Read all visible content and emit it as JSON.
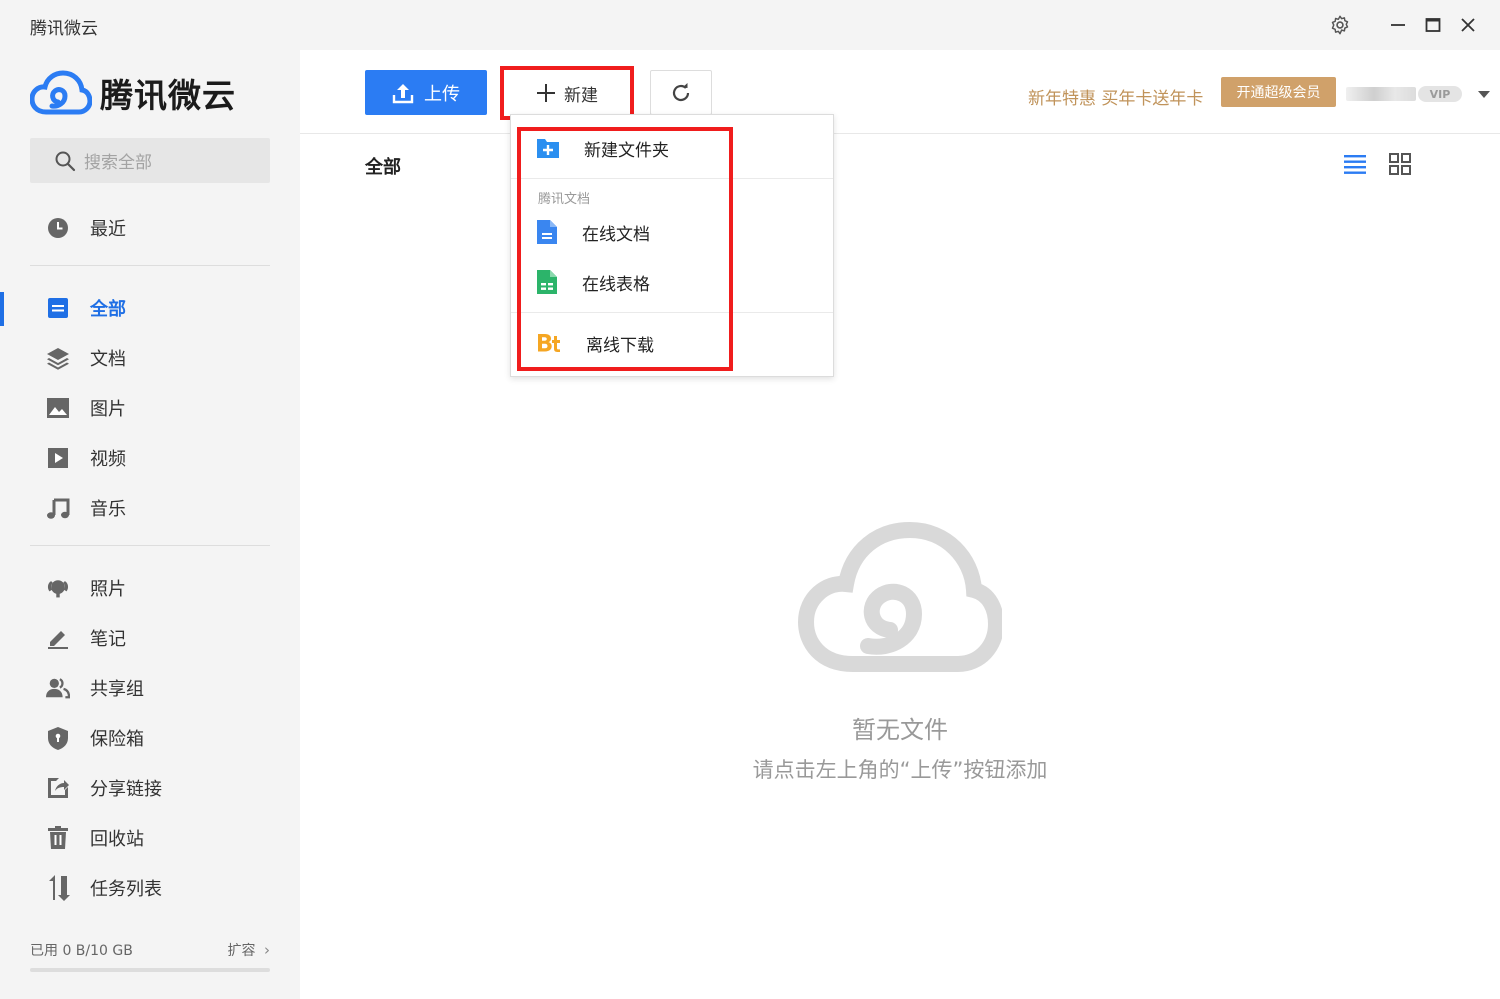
{
  "window": {
    "title": "腾讯微云"
  },
  "sidebar": {
    "logo_text": "腾讯微云",
    "search_placeholder": "搜索全部",
    "items": [
      {
        "label": "最近",
        "icon": "clock-icon"
      },
      {
        "label": "全部",
        "icon": "all-files-icon",
        "active": true
      },
      {
        "label": "文档",
        "icon": "layers-icon"
      },
      {
        "label": "图片",
        "icon": "image-icon"
      },
      {
        "label": "视频",
        "icon": "video-icon"
      },
      {
        "label": "音乐",
        "icon": "music-icon"
      },
      {
        "label": "照片",
        "icon": "photo-icon"
      },
      {
        "label": "笔记",
        "icon": "pen-icon"
      },
      {
        "label": "共享组",
        "icon": "group-icon"
      },
      {
        "label": "保险箱",
        "icon": "shield-icon"
      },
      {
        "label": "分享链接",
        "icon": "share-link-icon"
      },
      {
        "label": "回收站",
        "icon": "trash-icon"
      },
      {
        "label": "任务列表",
        "icon": "transfer-icon"
      }
    ],
    "storage_used": "已用 0 B/10 GB",
    "storage_expand": "扩容",
    "storage_fraction": 0
  },
  "toolbar": {
    "upload_label": "上传",
    "new_label": "新建",
    "promo_text": "新年特惠 买年卡送年卡",
    "vip_button": "开通超级会员",
    "vip_badge": "VIP"
  },
  "main": {
    "breadcrumb": "全部",
    "empty_title": "暂无文件",
    "empty_hint": "请点击左上角的“上传”按钮添加"
  },
  "new_menu": {
    "new_folder": "新建文件夹",
    "section_label": "腾讯文档",
    "online_doc": "在线文档",
    "online_sheet": "在线表格",
    "offline_download": "离线下载"
  },
  "colors": {
    "accent": "#2b7cf3",
    "highlight": "#f01d1d",
    "promo": "#c0935a"
  }
}
